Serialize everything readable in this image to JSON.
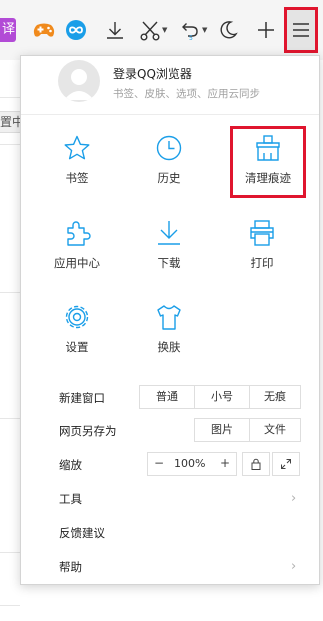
{
  "toolbar": {
    "translate_label": "译",
    "icons": [
      "translate-icon",
      "game-icon",
      "loop-icon",
      "download-icon",
      "scissors-icon",
      "undo-icon",
      "moon-icon",
      "plus-icon",
      "menu-icon"
    ],
    "accent": "#1a9ee8",
    "highlight": "#e0152e"
  },
  "background": {
    "setting_text": "置中"
  },
  "account": {
    "title": "登录QQ浏览器",
    "subtitle": "书签、皮肤、选项、应用云同步"
  },
  "grid": {
    "bookmarks": "书签",
    "history": "历史",
    "clear_traces": "清理痕迹",
    "app_center": "应用中心",
    "downloads": "下载",
    "print": "打印",
    "settings": "设置",
    "skin": "换肤"
  },
  "new_window": {
    "label": "新建窗口",
    "normal": "普通",
    "small": "小号",
    "incognito": "无痕"
  },
  "save_as": {
    "label": "网页另存为",
    "image": "图片",
    "file": "文件"
  },
  "zoom": {
    "label": "缩放",
    "minus": "−",
    "value": "100%",
    "plus": "+"
  },
  "menu": {
    "tools": "工具",
    "feedback": "反馈建议",
    "help": "帮助"
  }
}
